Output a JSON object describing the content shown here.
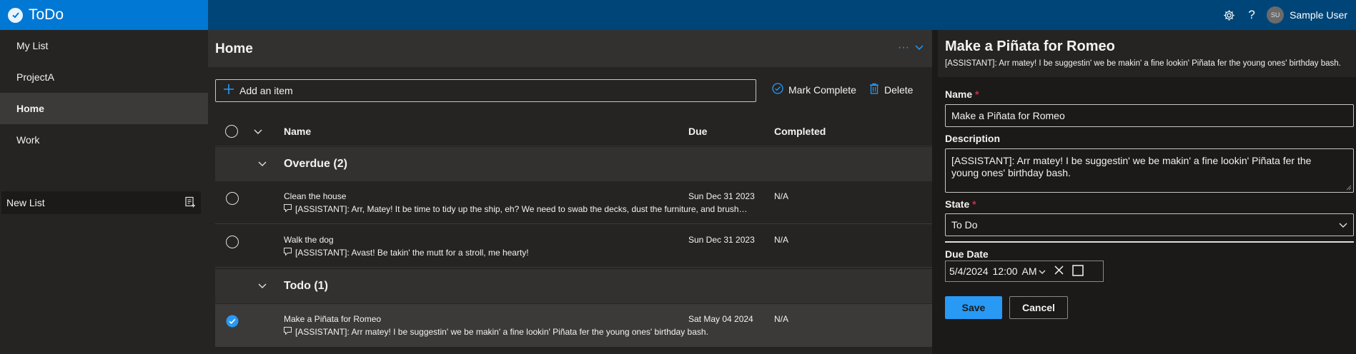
{
  "app": {
    "title": "ToDo"
  },
  "header": {
    "user_initials": "SU",
    "user_name": "Sample User"
  },
  "sidebar": {
    "items": [
      {
        "label": "My List",
        "active": false
      },
      {
        "label": "ProjectA",
        "active": false
      },
      {
        "label": "Home",
        "active": true
      },
      {
        "label": "Work",
        "active": false
      }
    ],
    "new_list_label": "New List"
  },
  "main": {
    "title": "Home",
    "add_item_label": "Add an item",
    "mark_complete_label": "Mark Complete",
    "delete_label": "Delete",
    "columns": {
      "name": "Name",
      "due": "Due",
      "completed": "Completed"
    },
    "groups": [
      {
        "label": "Overdue (2)",
        "items": [
          {
            "name": "Clean the house",
            "description": "[ASSISTANT]: Arr, Matey! It be time to tidy up the ship, eh? We need to swab the decks, dust the furniture, and brush o...",
            "due": "Sun Dec 31 2023",
            "completed": "N/A",
            "selected": false
          },
          {
            "name": "Walk the dog",
            "description": "[ASSISTANT]: Avast! Be takin' the mutt for a stroll, me hearty!",
            "due": "Sun Dec 31 2023",
            "completed": "N/A",
            "selected": false
          }
        ]
      },
      {
        "label": "Todo (1)",
        "items": [
          {
            "name": "Make a Piñata for Romeo",
            "description": "[ASSISTANT]: Arr matey! I be suggestin' we be makin' a fine lookin' Piñata fer the young ones' birthday bash.",
            "due": "Sat May 04 2024",
            "completed": "N/A",
            "selected": true
          }
        ]
      }
    ]
  },
  "detail": {
    "title": "Make a Piñata for Romeo",
    "subtitle": "[ASSISTANT]: Arr matey! I be suggestin' we be makin' a fine lookin' Piñata fer the young ones' birthday bash.",
    "name_label": "Name",
    "name_value": "Make a Piñata for Romeo",
    "description_label": "Description",
    "description_value": "[ASSISTANT]: Arr matey! I be suggestin' we be makin' a fine lookin' Piñata fer the young ones' birthday bash.",
    "state_label": "State",
    "state_value": "To Do",
    "due_label": "Due Date",
    "due_date": "5/4/2024",
    "due_time": "12:00",
    "due_ampm": "AM",
    "required_marker": "*",
    "save_label": "Save",
    "cancel_label": "Cancel"
  },
  "colors": {
    "accent": "#0078d4",
    "header": "#004578",
    "link": "#2899f5"
  }
}
